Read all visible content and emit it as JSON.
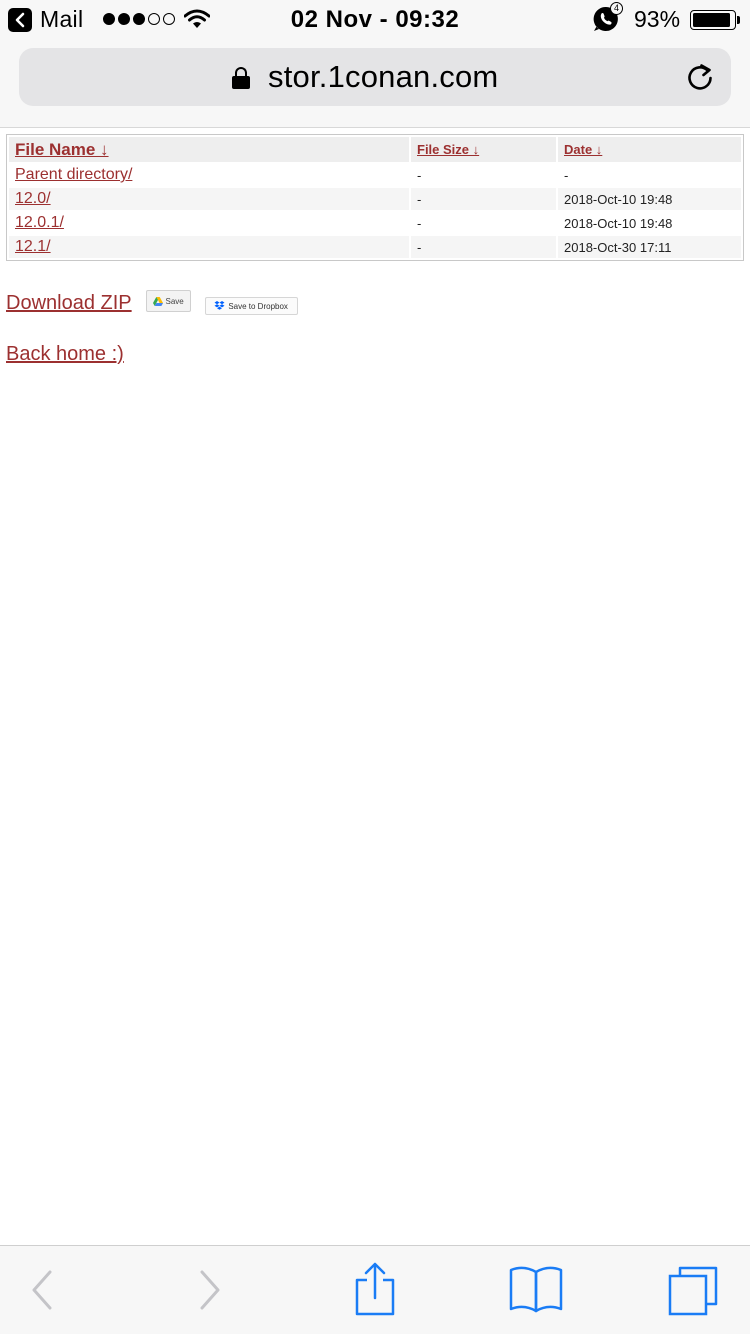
{
  "status_bar": {
    "back_app": "Mail",
    "time": "02 Nov - 09:32",
    "whatsapp_badge": "4",
    "battery_percent": "93%",
    "battery_level": 0.93,
    "signal_bars_filled": 3,
    "signal_bars_total": 5
  },
  "address_bar": {
    "url": "stor.1conan.com",
    "icons": [
      "lock-icon",
      "reload-icon"
    ]
  },
  "listing": {
    "headers": {
      "name": "File Name  ↓",
      "size": "File Size  ↓",
      "date": "Date  ↓"
    },
    "rows": [
      {
        "name": "Parent directory/",
        "size": "-",
        "date": "-"
      },
      {
        "name": "12.0/",
        "size": "-",
        "date": "2018-Oct-10 19:48"
      },
      {
        "name": "12.0.1/",
        "size": "-",
        "date": "2018-Oct-10 19:48"
      },
      {
        "name": "12.1/",
        "size": "-",
        "date": "2018-Oct-30 17:11"
      }
    ]
  },
  "actions": {
    "download_zip": "Download ZIP",
    "gdrive_save": "Save",
    "dropbox_save": "Save to Dropbox",
    "back_home": "Back home :)"
  },
  "toolbar": {
    "icons": [
      "back-icon",
      "forward-icon",
      "share-icon",
      "bookmarks-icon",
      "tabs-icon"
    ]
  },
  "colors": {
    "link": "#9c3030",
    "ios_blue": "#1a7cf5",
    "disabled": "#c4c4c8"
  }
}
